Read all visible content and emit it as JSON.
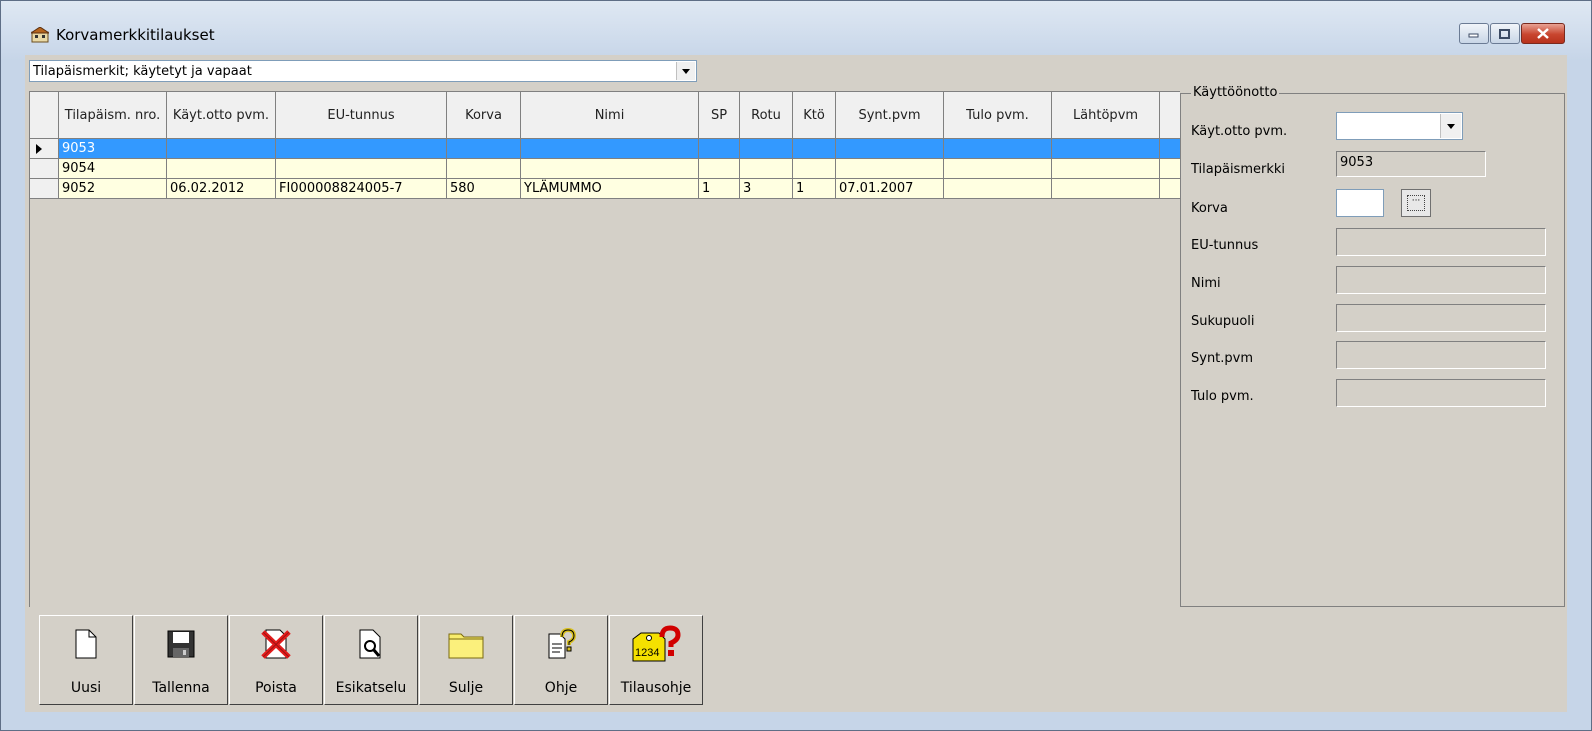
{
  "window": {
    "title": "Korvamerkkitilaukset"
  },
  "filter": {
    "selected": "Tilapäismerkit; käytetyt ja vapaat"
  },
  "grid": {
    "columns": [
      "Tilapäism. nro.",
      "Käyt.otto pvm.",
      "EU-tunnus",
      "Korva",
      "Nimi",
      "SP",
      "Rotu",
      "Ktö",
      "Synt.pvm",
      "Tulo pvm.",
      "Lähtöpvm"
    ],
    "rows": [
      {
        "cells": [
          "9053",
          "",
          "",
          "",
          "",
          "",
          "",
          "",
          "",
          "",
          ""
        ],
        "selected": true
      },
      {
        "cells": [
          "9054",
          "",
          "",
          "",
          "",
          "",
          "",
          "",
          "",
          "",
          ""
        ],
        "selected": false
      },
      {
        "cells": [
          "9052",
          "06.02.2012",
          "FI000008824005-7",
          "580",
          "YLÄMUMMO",
          "1",
          "3",
          "1",
          "07.01.2007",
          "",
          ""
        ],
        "selected": false
      }
    ]
  },
  "panel": {
    "title": "Käyttöönotto",
    "labels": {
      "kaytto_pvm": "Käyt.otto pvm.",
      "tilapaismerkki": "Tilapäismerkki",
      "korva": "Korva",
      "eu_tunnus": "EU-tunnus",
      "nimi": "Nimi",
      "sukupuoli": "Sukupuoli",
      "synt_pvm": "Synt.pvm",
      "tulo_pvm": "Tulo pvm."
    },
    "values": {
      "kaytto_pvm": "",
      "tilapaismerkki": "9053",
      "korva": "",
      "eu_tunnus": "",
      "nimi": "",
      "sukupuoli": "",
      "synt_pvm": "",
      "tulo_pvm": ""
    }
  },
  "toolbar": {
    "uusi": "Uusi",
    "tallenna": "Tallenna",
    "poista": "Poista",
    "esikatselu": "Esikatselu",
    "sulje": "Sulje",
    "ohje": "Ohje",
    "tilausohje": "Tilausohje",
    "tilausohje_icon_text": "1234"
  },
  "colors": {
    "selected_row": "#3399ff",
    "row_background": "#ffffe1",
    "panel_background": "#d4d0c8"
  }
}
